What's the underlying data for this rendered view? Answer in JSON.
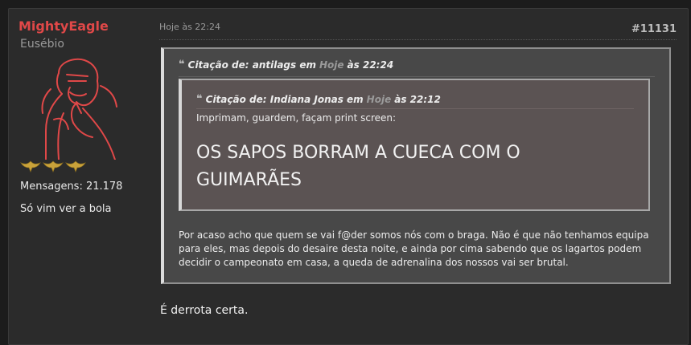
{
  "user": {
    "name": "MightyEagle",
    "title": "Eusébio",
    "posts_label": "Mensagens: 21.178",
    "signature": "Só vim ver a bola",
    "rank_stars": 3,
    "avatar_color": "#e04848"
  },
  "post": {
    "time": "Hoje às 22:24",
    "number": "#11131",
    "quote": {
      "prefix": "Citação de: antilags em",
      "link": "Hoje",
      "suffix": "às 22:24",
      "nested": {
        "prefix": "Citação de: Indiana Jonas em",
        "link": "Hoje",
        "suffix": "às 22:12",
        "line1": "Imprimam, guardem, façam print screen:",
        "big_text": "OS SAPOS BORRAM A CUECA COM O GUIMARÃES"
      },
      "text": "Por acaso acho que quem se vai f@der somos nós com o braga. Não é que não tenhamos equipa para eles, mas depois do desaire desta noite, e ainda por cima sabendo que os lagartos podem decidir o campeonato em casa, a queda de adrenalina dos nossos vai ser brutal."
    },
    "reply": "É derrota certa."
  },
  "icons": {
    "quote": "quote-icon",
    "rank": "eagle-rank-icon"
  }
}
